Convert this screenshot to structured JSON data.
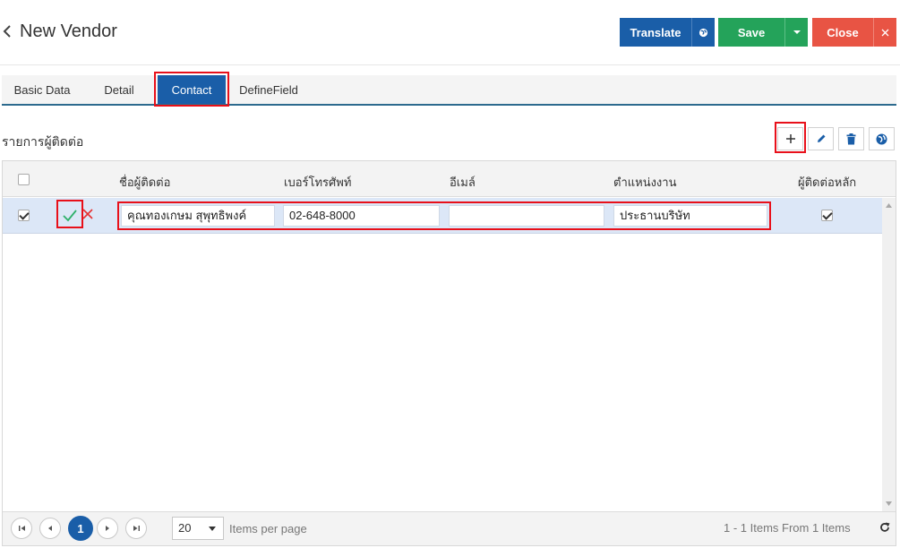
{
  "header": {
    "title": "New Vendor",
    "translate_label": "Translate",
    "save_label": "Save",
    "close_label": "Close"
  },
  "tabs": [
    {
      "label": "Basic Data"
    },
    {
      "label": "Detail"
    },
    {
      "label": "Contact",
      "active": true
    },
    {
      "label": "DefineField"
    }
  ],
  "section": {
    "title": "รายการผู้ติดต่อ"
  },
  "grid": {
    "columns": [
      "ชื่อผู้ติดต่อ",
      "เบอร์โทรศัพท์",
      "อีเมล์",
      "ตำแหน่งงาน",
      "ผู้ติดต่อหลัก"
    ],
    "rows": [
      {
        "selected": true,
        "name": "คุณทองเกษม สุพุทธิพงค์",
        "phone": "02-648-8000",
        "email": "",
        "position": "ประธานบริษัท",
        "primary": true
      }
    ]
  },
  "pager": {
    "current_page": "1",
    "page_size": "20",
    "items_per_page_label": "Items per page",
    "summary": "1 - 1 Items From 1 Items"
  },
  "colors": {
    "primary_blue": "#1a5ea8",
    "save_green": "#24a35a",
    "close_red": "#e85444",
    "highlight_red": "#e8101a",
    "row_selected": "#dce7f7"
  }
}
